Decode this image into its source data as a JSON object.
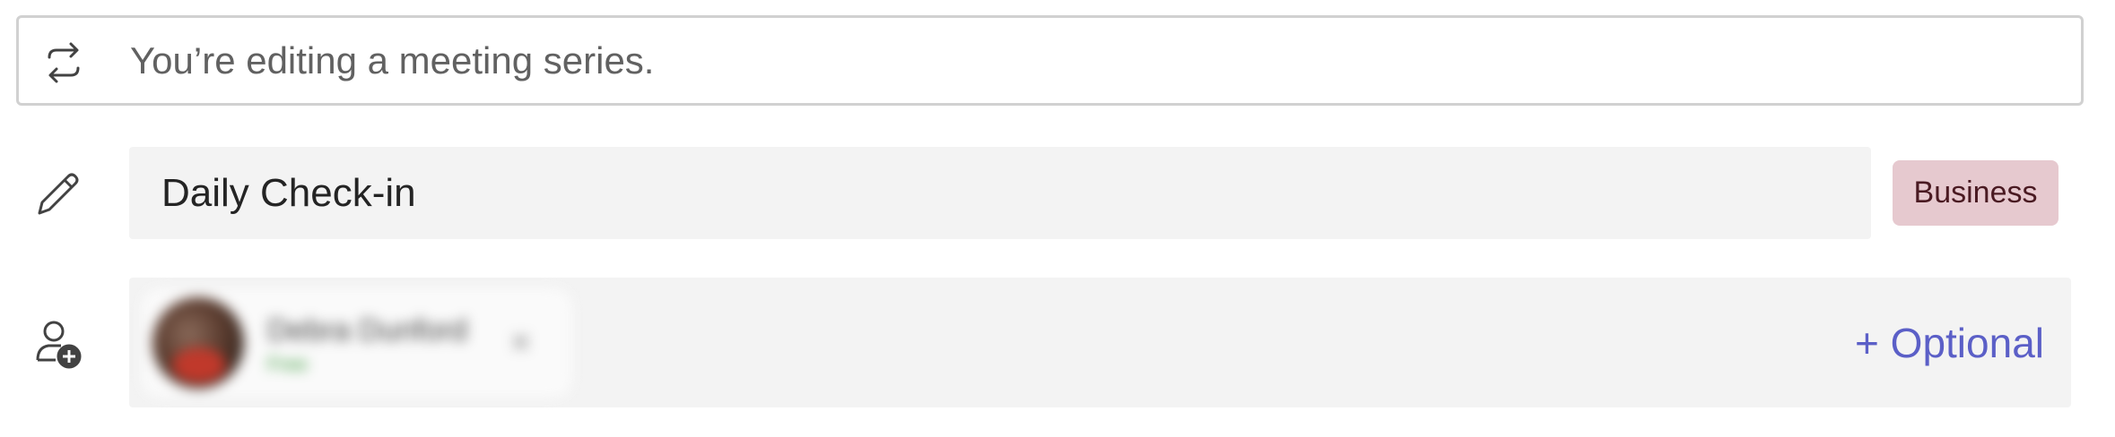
{
  "series": {
    "icon": "repeat-icon",
    "text": "You’re editing a meeting series."
  },
  "title": {
    "icon": "pencil-icon",
    "value": "Daily Check-in"
  },
  "category": {
    "label": "Business",
    "color": "#e6c9cf"
  },
  "attendees": {
    "icon": "add-person-icon",
    "list": [
      {
        "name": "Debra Dunford",
        "status": "Free"
      }
    ],
    "optional_label": "+ Optional"
  },
  "colors": {
    "accent": "#5b5fc7",
    "field_bg": "#f3f3f3",
    "status_free": "#3a9a3a"
  }
}
